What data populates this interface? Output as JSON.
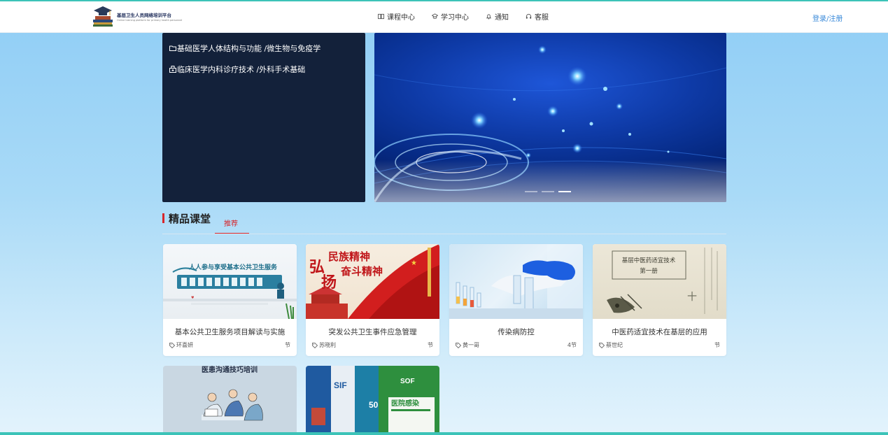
{
  "header": {
    "logo": {
      "title": "基层卫生人员网络培训平台",
      "subtitle": "Online training platform for primary health personnel"
    },
    "nav": [
      {
        "label": "课程中心",
        "icon": "book-icon"
      },
      {
        "label": "学习中心",
        "icon": "study-icon"
      },
      {
        "label": "通知",
        "icon": "bell-icon"
      },
      {
        "label": "客服",
        "icon": "headset-icon"
      }
    ],
    "login_label": "登录/注册"
  },
  "categories": [
    {
      "icon": "folder-icon",
      "label": "基础医学人体结构与功能 /微生物与免疫学"
    },
    {
      "icon": "clinic-icon",
      "label": "临床医学内科诊疗技术 /外科手术基础"
    }
  ],
  "banner": {
    "slides": 3,
    "active": 2
  },
  "section": {
    "title": "精品课堂",
    "tab": "推荐"
  },
  "courses": [
    {
      "title": "基本公共卫生服务项目解读与实施",
      "author": "环喜妍",
      "count": "节"
    },
    {
      "title": "突发公共卫生事件应急管理",
      "author": "苏晓利",
      "count": "节"
    },
    {
      "title": "传染病防控",
      "author": "黄一哥",
      "count": "4节"
    },
    {
      "title": "中医药适宜技术在基层的应用",
      "author": "蔡世纪",
      "count": "节"
    }
  ],
  "course_images_text": {
    "card1": "人人参与享受基本公共卫生服务",
    "card2_line1": "民族精神",
    "card2_line2": "奋斗精神",
    "card2_big1": "弘",
    "card2_big2": "扬",
    "card4_title": "基层中医药适宜技术",
    "card4_sub": "第一册",
    "card5": "医患沟通技巧培训",
    "card6_a": "SOF",
    "card6_b": "医院感染",
    "card6_c": "SIF",
    "card6_d": "50"
  },
  "colors": {
    "accent": "#d7262b",
    "header_line": "#3cc3b8",
    "panel": "#13213a",
    "link": "#3a8ad9"
  }
}
